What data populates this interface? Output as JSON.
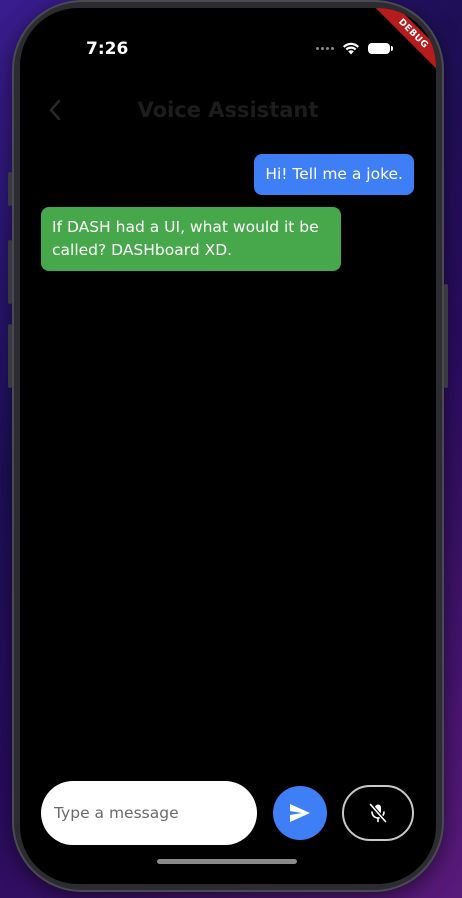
{
  "status_bar": {
    "time": "7:26",
    "debug_banner": "DEBUG"
  },
  "app_bar": {
    "title": "Voice Assistant",
    "back_icon": "chevron-left-icon"
  },
  "messages": [
    {
      "sender": "user",
      "text": "Hi! Tell me a joke.",
      "color": "#3f7ff6"
    },
    {
      "sender": "assistant",
      "text": "If DASH had a UI, what would it be called? DASHboard XD.",
      "color": "#46a84a"
    }
  ],
  "composer": {
    "placeholder": "Type a message",
    "value": "",
    "send_icon": "send-icon",
    "mic_icon": "mic-off-icon"
  },
  "colors": {
    "accent": "#3f7ff6",
    "assistant_bubble": "#46a84a",
    "background": "#000000",
    "debug_ribbon": "#b71c1c"
  }
}
